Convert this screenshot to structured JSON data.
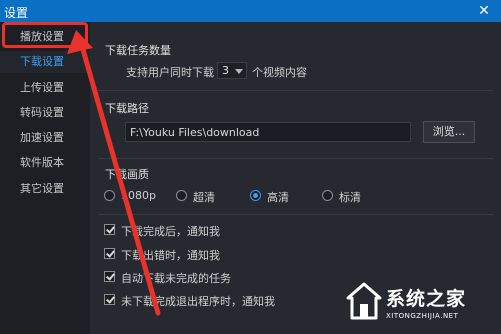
{
  "window": {
    "title": "设置",
    "close_glyph": "✕"
  },
  "sidebar": {
    "items": [
      {
        "label": "播放设置"
      },
      {
        "label": "下载设置"
      },
      {
        "label": "上传设置"
      },
      {
        "label": "转码设置"
      },
      {
        "label": "加速设置"
      },
      {
        "label": "软件版本"
      },
      {
        "label": "其它设置"
      }
    ],
    "active_index": 1
  },
  "download_count": {
    "title": "下载任务数量",
    "prefix": "支持用户同时下载",
    "value": "3",
    "suffix": "个视频内容"
  },
  "download_path": {
    "title": "下载路径",
    "value": "F:\\Youku Files\\download",
    "browse_label": "浏览..."
  },
  "quality": {
    "title": "下载画质",
    "options": [
      "1080p",
      "超清",
      "高清",
      "标清"
    ],
    "selected": "高清"
  },
  "notifications": [
    {
      "label": "下载完成后，通知我",
      "checked": true
    },
    {
      "label": "下载出错时，通知我",
      "checked": true
    },
    {
      "label": "自动下载未完成的任务",
      "checked": true
    },
    {
      "label": "未下载完成退出程序时，通知我",
      "checked": true
    }
  ],
  "watermark": {
    "text": "系统之家",
    "url": "XITONGZHIJIA.NET",
    "icon": "house-logo-icon"
  },
  "colors": {
    "titlebar": "#0b6fc3",
    "accent": "#3b9ef5",
    "annotation": "#e8322b"
  }
}
